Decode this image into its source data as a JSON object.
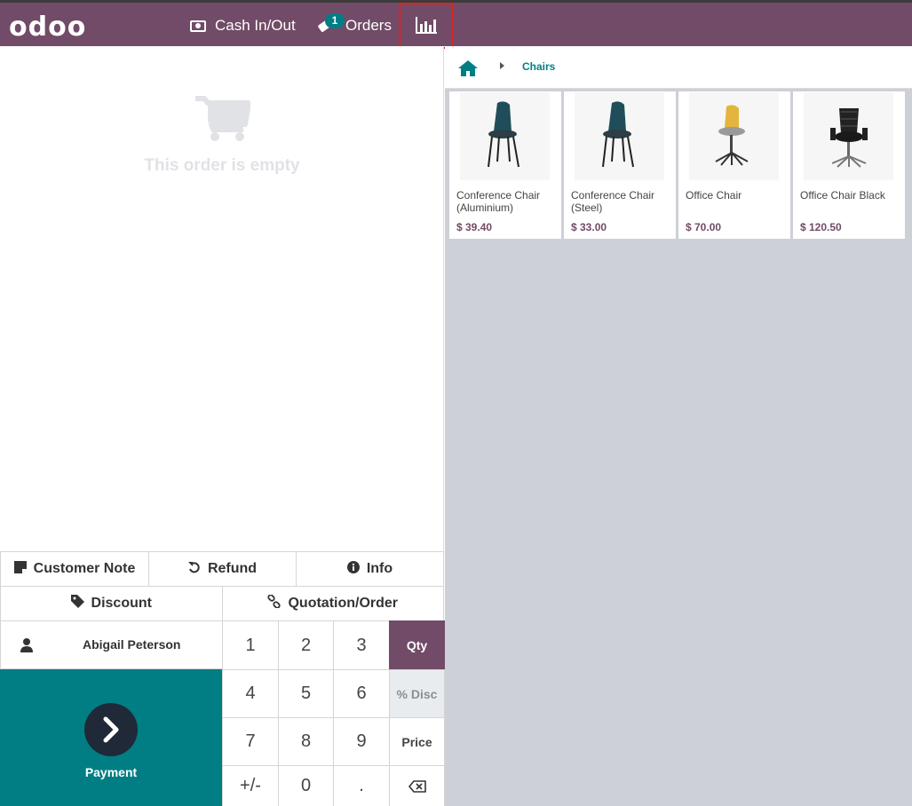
{
  "header": {
    "logo": "odoo",
    "cash_label": "Cash In/Out",
    "orders_label": "Orders",
    "orders_badge": "1",
    "stats_icon": "bar-chart-icon"
  },
  "order": {
    "empty_text": "This order is empty"
  },
  "controls": {
    "customer_note": "Customer Note",
    "refund": "Refund",
    "info": "Info",
    "discount": "Discount",
    "quotation": "Quotation/Order",
    "customer_name": "Abigail Peterson",
    "payment": "Payment"
  },
  "numpad": {
    "keys": [
      "1",
      "2",
      "3",
      "4",
      "5",
      "6",
      "7",
      "8",
      "9",
      "+/-",
      "0",
      "."
    ],
    "modes": {
      "qty": "Qty",
      "disc": "% Disc",
      "price": "Price"
    },
    "active_mode": "Qty"
  },
  "breadcrumb": {
    "category": "Chairs"
  },
  "products": [
    {
      "name": "Conference Chair (Aluminium)",
      "price": "$ 39.40"
    },
    {
      "name": "Conference Chair (Steel)",
      "price": "$ 33.00"
    },
    {
      "name": "Office Chair",
      "price": "$ 70.00"
    },
    {
      "name": "Office Chair Black",
      "price": "$ 120.50"
    }
  ],
  "colors": {
    "brand": "#714b67",
    "accent": "#017e84",
    "highlight": "#e3211f"
  }
}
